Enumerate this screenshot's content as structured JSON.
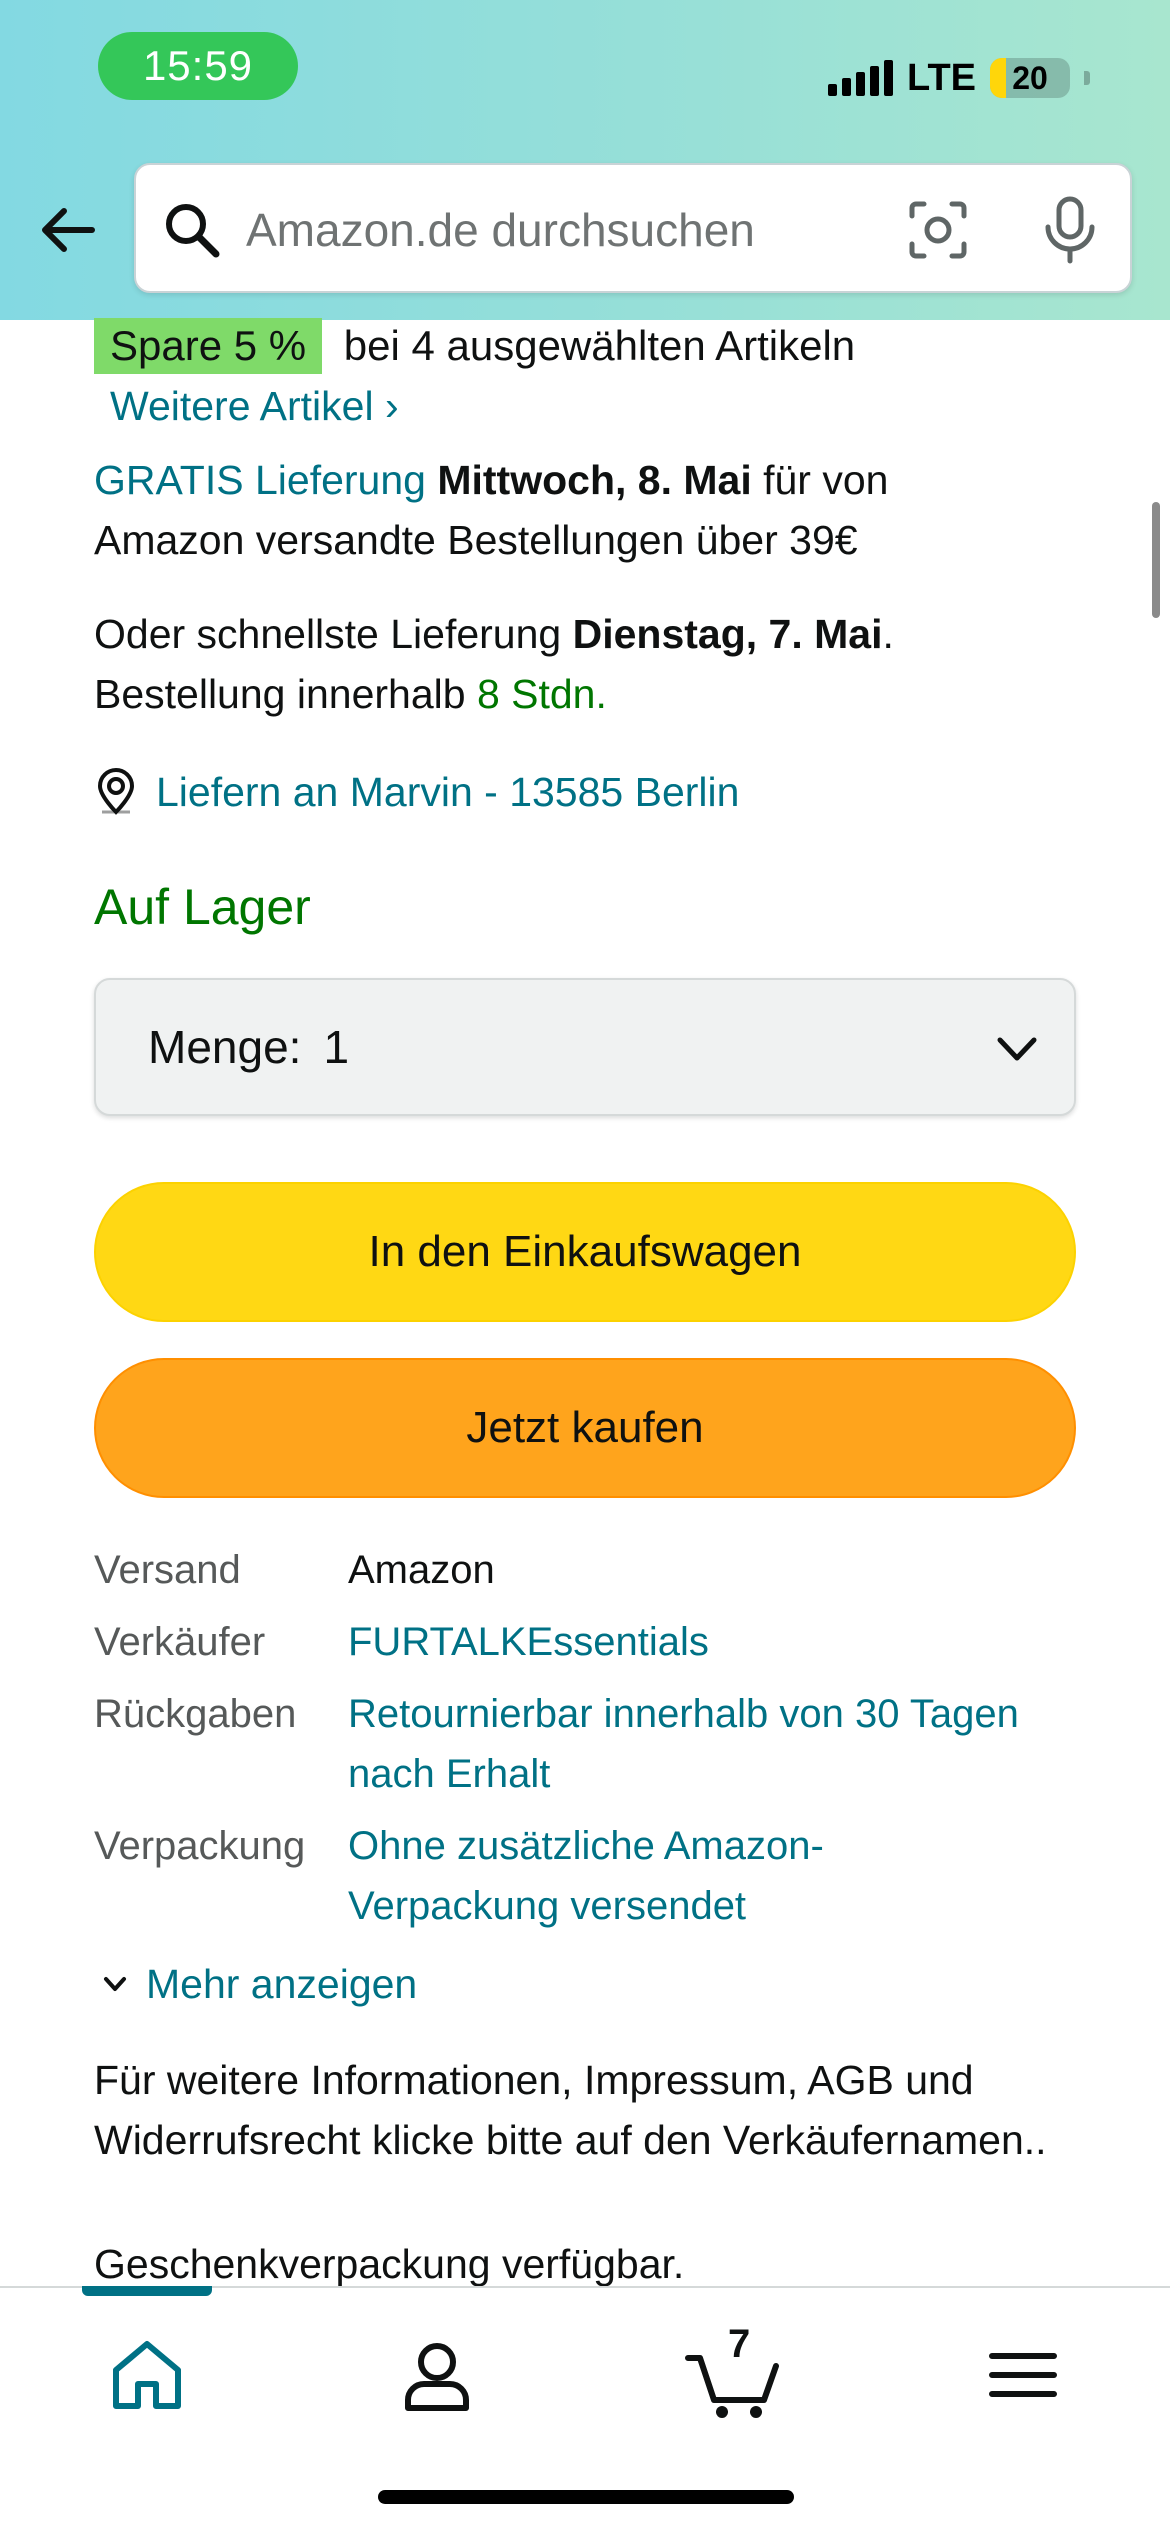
{
  "status_bar": {
    "time": "15:59",
    "network": "LTE",
    "battery": "20",
    "battery_level": 0.2
  },
  "search": {
    "placeholder": "Amazon.de durchsuchen"
  },
  "promo": {
    "badge": "Spare 5 %",
    "text": "bei 4 ausgewählten Artikeln",
    "link": "Weitere Artikel ›"
  },
  "delivery": {
    "free_link": "GRATIS Lieferung",
    "free_date": "Mittwoch, 8. Mai",
    "free_suffix": " für von",
    "free_line2": "Amazon versandte Bestellungen über 39€",
    "fast_prefix": "Oder schnellste Lieferung ",
    "fast_date": "Dienstag, 7. Mai",
    "fast_suffix": ".",
    "order_prefix": "Bestellung innerhalb ",
    "order_time": "8 Stdn.",
    "location": "Liefern an Marvin - 13585 Berlin"
  },
  "stock": {
    "status": "Auf Lager"
  },
  "quantity": {
    "label": "Menge:",
    "value": "1"
  },
  "buttons": {
    "add_to_cart": "In den Einkaufswagen",
    "buy_now": "Jetzt kaufen"
  },
  "details": [
    {
      "label": "Versand",
      "value": "Amazon"
    },
    {
      "label": "Verkäufer",
      "value": "FURTALKEssentials"
    },
    {
      "label": "Rückgaben",
      "value": "Retournierbar innerhalb von 30 Tagen nach Erhalt"
    },
    {
      "label": "Verpackung",
      "value": "Ohne zusätzliche Amazon-Verpackung versendet"
    }
  ],
  "more_link": "Mehr anzeigen",
  "info_text": "Für weitere Informationen, Impressum, AGB und Widerrufsrecht klicke bitte auf den Verkäufernamen..",
  "gift_text": "Geschenkverpackung verfügbar.",
  "bottom_nav": {
    "items": [
      "home-icon",
      "account-icon",
      "cart-icon",
      "menu-icon"
    ],
    "cart_count": "7",
    "active": "home"
  },
  "colors": {
    "link": "#007185",
    "green": "#007600",
    "cart_button": "#FFD814",
    "buy_button": "#FFA41C",
    "badge": "#7FDA69"
  }
}
